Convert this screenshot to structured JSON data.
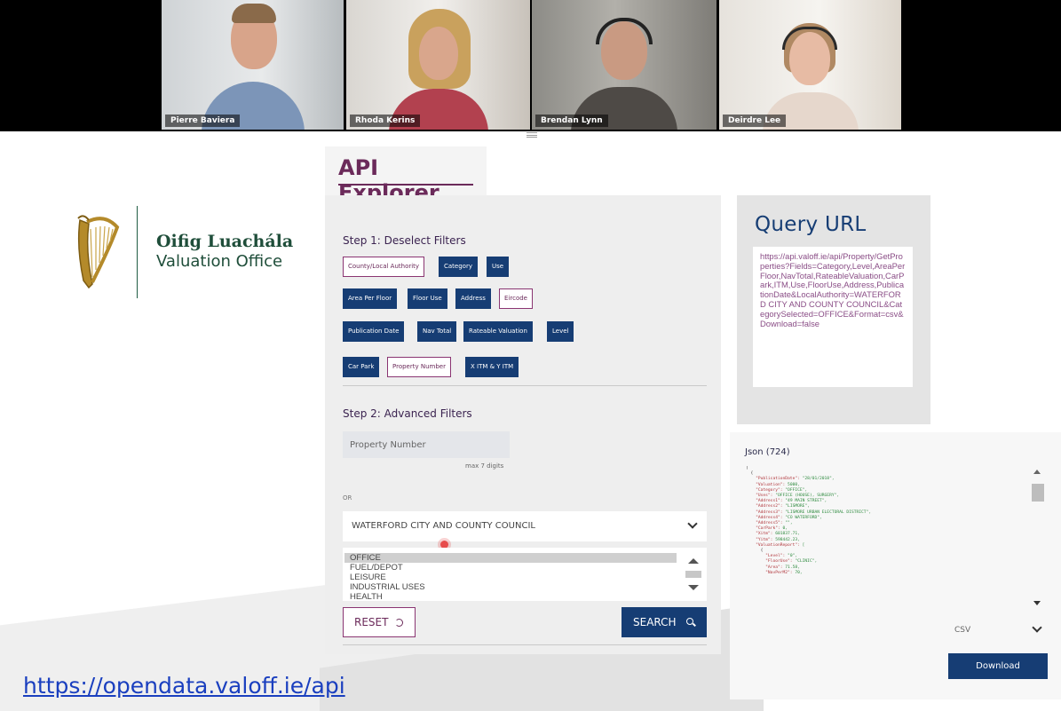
{
  "call": {
    "participants": [
      {
        "name": "Pierre Baviera"
      },
      {
        "name": "Rhoda Kerins"
      },
      {
        "name": "Brendan Lynn"
      },
      {
        "name": "Deirdre Lee"
      }
    ]
  },
  "logo": {
    "irish_name": "Oifig Luachála",
    "english_name": "Valuation Office"
  },
  "explorer": {
    "title": "API Explorer",
    "step1": {
      "title": "Step 1: Deselect Filters",
      "filters": [
        {
          "label": "County/Local Authority",
          "selected": false
        },
        {
          "label": "Category",
          "selected": true
        },
        {
          "label": "Use",
          "selected": true
        },
        {
          "label": "Area Per Floor",
          "selected": true
        },
        {
          "label": "Floor Use",
          "selected": true
        },
        {
          "label": "Address",
          "selected": true
        },
        {
          "label": "Eircode",
          "selected": false
        },
        {
          "label": "Publication Date",
          "selected": true
        },
        {
          "label": "Nav Total",
          "selected": true
        },
        {
          "label": "Rateable Valuation",
          "selected": true
        },
        {
          "label": "Level",
          "selected": true
        },
        {
          "label": "Car Park",
          "selected": true
        },
        {
          "label": "Property Number",
          "selected": false
        },
        {
          "label": "X ITM & Y ITM",
          "selected": true
        }
      ]
    },
    "step2": {
      "title": "Step 2: Advanced Filters",
      "property_placeholder": "Property Number",
      "max_hint": "max 7 digits",
      "or_label": "OR",
      "council_value": "WATERFORD CITY AND COUNTY COUNCIL",
      "categories": [
        "OFFICE",
        "FUEL/DEPOT",
        "LEISURE",
        "INDUSTRIAL USES",
        "HEALTH"
      ],
      "selected_category": "OFFICE"
    },
    "reset_label": "RESET",
    "search_label": "SEARCH"
  },
  "query": {
    "title": "Query URL",
    "url": "https://api.valoff.ie/api/Property/GetProperties?Fields=Category,Level,AreaPerFloor,NavTotal,RateableValuation,CarPark,ITM,Use,FloorUse,Address,PublicationDate&LocalAuthority=WATERFORD CITY AND COUNTY COUNCIL&CategorySelected=OFFICE&Format=csv&Download=false"
  },
  "json": {
    "title": "Json (724)",
    "lines": [
      [
        "",
        "[",
        ""
      ],
      [
        "  ",
        "{",
        ""
      ],
      [
        "    ",
        "\"PublicationDate\": ",
        "\"28/01/2018\","
      ],
      [
        "    ",
        "\"Valuation\": ",
        "5000,"
      ],
      [
        "    ",
        "\"Category\": ",
        "\"OFFICE\","
      ],
      [
        "    ",
        "\"Uses\": ",
        "\"OFFICE (HOUSE), SURGERY\","
      ],
      [
        "    ",
        "\"Address1\": ",
        "\"49 MAIN STREET\","
      ],
      [
        "    ",
        "\"Address2\": ",
        "\"LISMORE\","
      ],
      [
        "    ",
        "\"Address3\": ",
        "\"LISMORE URBAN ELECTORAL DISTRICT\","
      ],
      [
        "    ",
        "\"Address4\": ",
        "\"CO WATERFORD\","
      ],
      [
        "    ",
        "\"Address5\": ",
        "\"\","
      ],
      [
        "    ",
        "\"CarPark\": ",
        "0,"
      ],
      [
        "    ",
        "\"Xitm\": ",
        "601837.71,"
      ],
      [
        "    ",
        "\"Yitm\": ",
        "598442.23,"
      ],
      [
        "    ",
        "\"ValuationReport\": ",
        "["
      ],
      [
        "      ",
        "{",
        ""
      ],
      [
        "        ",
        "\"Level\": ",
        "\"0\","
      ],
      [
        "        ",
        "\"FloorUse\": ",
        "\"CLINIC\","
      ],
      [
        "        ",
        "\"Area\": ",
        "71.58,"
      ],
      [
        "        ",
        "\"NavPerM2\": ",
        "70,"
      ]
    ],
    "format_value": "CSV",
    "download_label": "Download"
  },
  "link": {
    "text": "https://opendata.valoff.ie/api"
  },
  "colors": {
    "brand_purple": "#6b2a5a",
    "brand_navy": "#163d74",
    "logo_green": "#1f4e3a",
    "active_speaker": "#2aa876"
  }
}
